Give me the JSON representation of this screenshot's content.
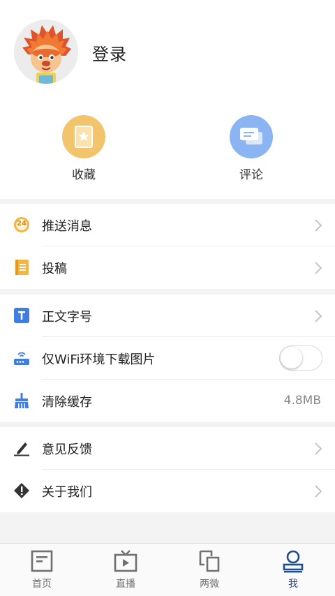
{
  "profile": {
    "login_label": "登录"
  },
  "quick_actions": [
    {
      "label": "收藏",
      "icon": "bookmark-icon",
      "color": "#f2c46b"
    },
    {
      "label": "评论",
      "icon": "chat-icon",
      "color": "#8ab4f2"
    }
  ],
  "menu": {
    "push_label": "推送消息",
    "push_badge": "24",
    "contribute_label": "投稿",
    "font_size_label": "正文字号",
    "wifi_images_label": "仅WiFi环境下载图片",
    "wifi_images_enabled": false,
    "clear_cache_label": "清除缓存",
    "cache_size": "4.8MB",
    "feedback_label": "意见反馈",
    "about_label": "关于我们"
  },
  "tabbar": {
    "items": [
      {
        "label": "首页",
        "icon": "home-news-icon"
      },
      {
        "label": "直播",
        "icon": "tv-icon"
      },
      {
        "label": "两微",
        "icon": "two-micro-icon"
      },
      {
        "label": "我",
        "icon": "user-icon",
        "active": true
      }
    ]
  },
  "colors": {
    "accent": "#1f4e8c",
    "background": "#f3f3f3",
    "bookmark": "#f2c46b",
    "comment": "#8ab4f2"
  }
}
